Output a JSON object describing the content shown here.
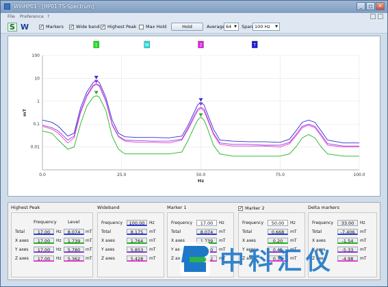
{
  "window": {
    "title": "WinHP01 - [HP01-TS-Spectrum]",
    "buttons": [
      "_",
      "◻",
      "✕"
    ]
  },
  "menu": [
    "File",
    "Preference",
    "?"
  ],
  "toolbar": {
    "logo_s": "S",
    "logo_w": "W",
    "checkboxes": [
      {
        "label": "Markers",
        "checked": true
      },
      {
        "label": "Wide band",
        "checked": true
      },
      {
        "label": "Highest Peak",
        "checked": true
      },
      {
        "label": "Max Hold",
        "checked": false
      }
    ],
    "hold_label": "Hold",
    "average_label": "Average",
    "average_value": "64",
    "span_label": "Span",
    "span_value": "100 Hz"
  },
  "chart_data": {
    "type": "line",
    "xlabel": "Hz",
    "ylabel": "mT",
    "xlim": [
      0,
      100
    ],
    "ylim": [
      0.001,
      100
    ],
    "y_scale": "log",
    "x_ticks": [
      "0.0",
      "25.0",
      "50.0",
      "75.0",
      "100.0"
    ],
    "y_ticks": [
      "100",
      "10",
      "1",
      "0.1",
      "0.01"
    ],
    "grid": true,
    "marker_flags": [
      {
        "label": "1",
        "x": 17,
        "color": "#22dd22"
      },
      {
        "label": "W",
        "x": 33,
        "color": "#22dddd"
      },
      {
        "label": "2",
        "x": 50,
        "color": "#dd22dd"
      },
      {
        "label": "T",
        "x": 67,
        "color": "#1a1ad6"
      }
    ],
    "series": [
      {
        "color": "#2b2bd9",
        "x": [
          0,
          3,
          5,
          8,
          10,
          12,
          14,
          16,
          17,
          18,
          20,
          22,
          24,
          26,
          30,
          35,
          40,
          44,
          46,
          48,
          49,
          50,
          51,
          52,
          54,
          56,
          60,
          65,
          70,
          75,
          78,
          80,
          82,
          84,
          86,
          88,
          90,
          95,
          100
        ],
        "y": [
          0.15,
          0.12,
          0.08,
          0.03,
          0.04,
          0.5,
          2.5,
          6.5,
          8.07,
          6.5,
          1.5,
          0.15,
          0.04,
          0.028,
          0.026,
          0.026,
          0.025,
          0.03,
          0.09,
          0.35,
          0.7,
          0.9,
          0.7,
          0.3,
          0.06,
          0.02,
          0.018,
          0.017,
          0.017,
          0.016,
          0.022,
          0.05,
          0.12,
          0.15,
          0.12,
          0.05,
          0.02,
          0.015,
          0.015
        ]
      },
      {
        "color": "#9a3ad6",
        "x": [
          0,
          3,
          5,
          8,
          10,
          12,
          14,
          16,
          17,
          18,
          20,
          22,
          24,
          26,
          30,
          35,
          40,
          44,
          46,
          48,
          49,
          50,
          51,
          52,
          54,
          56,
          60,
          65,
          70,
          75,
          78,
          80,
          82,
          84,
          86,
          88,
          90,
          95,
          100
        ],
        "y": [
          0.09,
          0.07,
          0.05,
          0.02,
          0.03,
          0.35,
          1.8,
          5,
          5.78,
          5,
          1.1,
          0.1,
          0.03,
          0.02,
          0.019,
          0.018,
          0.018,
          0.022,
          0.07,
          0.25,
          0.45,
          0.55,
          0.45,
          0.2,
          0.04,
          0.015,
          0.013,
          0.013,
          0.012,
          0.012,
          0.016,
          0.035,
          0.08,
          0.1,
          0.08,
          0.035,
          0.014,
          0.011,
          0.011
        ]
      },
      {
        "color": "#e83ad6",
        "x": [
          0,
          3,
          5,
          8,
          10,
          12,
          14,
          16,
          17,
          18,
          20,
          22,
          24,
          26,
          30,
          35,
          40,
          44,
          46,
          48,
          49,
          50,
          51,
          52,
          54,
          56,
          60,
          65,
          70,
          75,
          78,
          80,
          82,
          84,
          86,
          88,
          90,
          95,
          100
        ],
        "y": [
          0.08,
          0.06,
          0.04,
          0.015,
          0.025,
          0.3,
          1.6,
          4.5,
          5.36,
          4.5,
          1,
          0.09,
          0.028,
          0.018,
          0.016,
          0.016,
          0.015,
          0.02,
          0.06,
          0.2,
          0.38,
          0.5,
          0.38,
          0.17,
          0.035,
          0.013,
          0.011,
          0.011,
          0.011,
          0.01,
          0.014,
          0.03,
          0.07,
          0.09,
          0.07,
          0.03,
          0.012,
          0.01,
          0.01
        ]
      },
      {
        "color": "#1db31d",
        "x": [
          0,
          3,
          5,
          8,
          10,
          12,
          14,
          16,
          17,
          18,
          20,
          22,
          24,
          26,
          30,
          35,
          40,
          44,
          46,
          48,
          49,
          50,
          51,
          52,
          54,
          56,
          60,
          65,
          70,
          75,
          78,
          80,
          82,
          84,
          86,
          88,
          90,
          95,
          100
        ],
        "y": [
          0.05,
          0.04,
          0.02,
          0.008,
          0.01,
          0.1,
          0.6,
          1.5,
          1.74,
          1.5,
          0.4,
          0.03,
          0.008,
          0.005,
          0.005,
          0.005,
          0.005,
          0.006,
          0.02,
          0.08,
          0.15,
          0.2,
          0.15,
          0.07,
          0.012,
          0.005,
          0.004,
          0.004,
          0.004,
          0.004,
          0.005,
          0.01,
          0.025,
          0.035,
          0.025,
          0.01,
          0.005,
          0.004,
          0.004
        ]
      }
    ],
    "peak_markers": [
      {
        "x": 17,
        "y": 10.5,
        "color": "#2b2bd9"
      },
      {
        "x": 17,
        "y": 7.0,
        "color": "#9a3ad6"
      },
      {
        "x": 17,
        "y": 2.3,
        "color": "#1db31d"
      },
      {
        "x": 50,
        "y": 1.1,
        "color": "#2b2bd9"
      },
      {
        "x": 50,
        "y": 0.72,
        "color": "#9a3ad6"
      },
      {
        "x": 50,
        "y": 0.24,
        "color": "#1db31d"
      }
    ]
  },
  "panels": {
    "highest_peak": {
      "title": "Highest Peak",
      "col_freq": "Frequency",
      "col_level": "Level",
      "rows": [
        {
          "label": "Total",
          "freq": "17.00",
          "f_unit": "Hz",
          "level": "8.074",
          "l_unit": "mT"
        },
        {
          "label": "X axes",
          "freq": "17.00",
          "f_unit": "Hz",
          "level": "1.739",
          "l_unit": "mT"
        },
        {
          "label": "Y axes",
          "freq": "17.00",
          "f_unit": "Hz",
          "level": "5.780",
          "l_unit": "mT"
        },
        {
          "label": "Z axes",
          "freq": "17.00",
          "f_unit": "Hz",
          "level": "5.362",
          "l_unit": "mT"
        }
      ]
    },
    "wideband": {
      "title": "Wideband",
      "freq_label": "Frequency",
      "freq_value": "100.00",
      "freq_unit": "Hz",
      "rows": [
        {
          "label": "Total",
          "value": "8.175",
          "unit": "mT"
        },
        {
          "label": "X axes",
          "value": "1.764",
          "unit": "mT"
        },
        {
          "label": "Y axes",
          "value": "5.853",
          "unit": "mT"
        },
        {
          "label": "Z axes",
          "value": "5.428",
          "unit": "mT"
        }
      ]
    },
    "marker1": {
      "title": "Marker 1",
      "freq_label": "Frequency",
      "freq_value": "17.00",
      "freq_unit": "Hz",
      "rows": [
        {
          "label": "Total",
          "value": "8.074",
          "unit": "mT"
        },
        {
          "label": "X axes",
          "value": "1.739",
          "unit": "mT"
        },
        {
          "label": "Y axes",
          "value": "5.780",
          "unit": "mT"
        },
        {
          "label": "Z axes",
          "value": "5.362",
          "unit": "mT"
        }
      ]
    },
    "marker2": {
      "title": "Marker 2",
      "freq_label": "Frequency",
      "freq_value": "50.00",
      "freq_unit": "Hz",
      "rows": [
        {
          "label": "Total",
          "value": "0.668",
          "unit": "mT"
        },
        {
          "label": "X axes",
          "value": "0.20",
          "unit": "mT"
        },
        {
          "label": "Y axes",
          "value": "0.45",
          "unit": "mT"
        },
        {
          "label": "Z axes",
          "value": "0.38",
          "unit": "mT"
        }
      ]
    },
    "delta": {
      "title": "Delta markers",
      "freq_label": "Frequency",
      "freq_value": "33.00",
      "freq_unit": "Hz",
      "rows": [
        {
          "label": "Total",
          "value": "-7.406",
          "unit": "mT"
        },
        {
          "label": "X axes",
          "value": "-1.54",
          "unit": "mT"
        },
        {
          "label": "Y axes",
          "value": "-5.33",
          "unit": "mT"
        },
        {
          "label": "Z axes",
          "value": "-4.98",
          "unit": "mT"
        }
      ]
    }
  },
  "watermark": {
    "text": "中科汇仪"
  },
  "colors": {
    "total": "#2a3bd6",
    "x": "#1db31d",
    "y": "#8a3bd6",
    "z": "#e83ad6",
    "watermark_blue": "#1e78c8",
    "watermark_green": "#2db34a"
  }
}
